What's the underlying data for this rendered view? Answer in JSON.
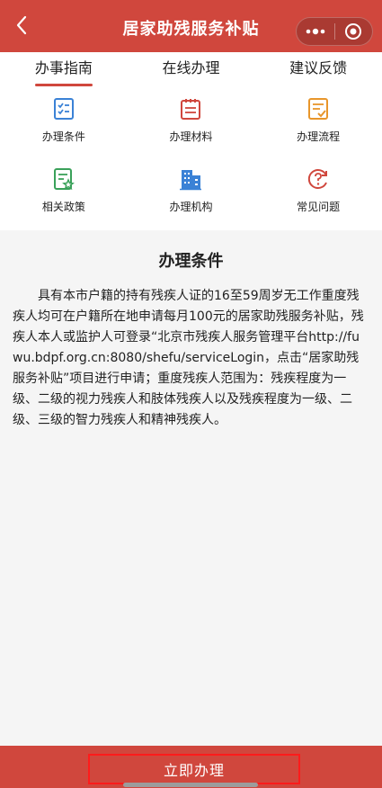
{
  "navbar": {
    "title": "居家助残服务补贴",
    "back_icon": "chevron-left-icon",
    "more_icon": "more-dots-icon",
    "close_icon": "target-circle-icon"
  },
  "tabs": [
    {
      "label": "办事指南",
      "active": true
    },
    {
      "label": "在线办理",
      "active": false
    },
    {
      "label": "建议反馈",
      "active": false
    }
  ],
  "grid": [
    {
      "label": "办理条件",
      "icon": "checklist-icon",
      "color": "#3b82d6"
    },
    {
      "label": "办理材料",
      "icon": "notepad-icon",
      "color": "#d0473d"
    },
    {
      "label": "办理流程",
      "icon": "flow-document-icon",
      "color": "#e8962b"
    },
    {
      "label": "相关政策",
      "icon": "policy-star-icon",
      "color": "#3aa15a"
    },
    {
      "label": "办理机构",
      "icon": "building-icon",
      "color": "#3b82d6"
    },
    {
      "label": "常见问题",
      "icon": "question-refresh-icon",
      "color": "#d0473d"
    }
  ],
  "content": {
    "title": "办理条件",
    "body": "具有本市户籍的持有残疾人证的16至59周岁无工作重度残疾人均可在户籍所在地申请每月100元的居家助残服务补贴，残疾人本人或监护人可登录“北京市残疾人服务管理平台http://fuwu.bdpf.org.cn:8080/shefu/serviceLogin，点击“居家助残服务补贴”项目进行申请；重度残疾人范围为：残疾程度为一级、二级的视力残疾人和肢体残疾人以及残疾程度为一级、二级、三级的智力残疾人和精神残疾人。"
  },
  "bottom": {
    "apply_label": "立即办理"
  },
  "colors": {
    "brand": "#d0473d",
    "highlight_border": "#ff1b1b"
  }
}
